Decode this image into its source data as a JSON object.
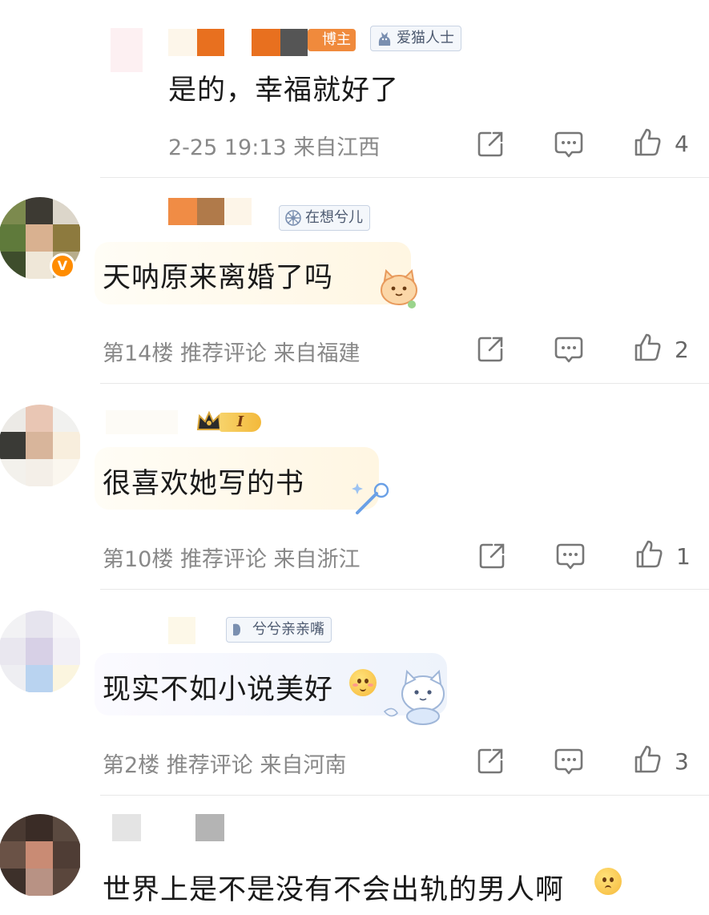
{
  "comments": [
    {
      "badge": "博主",
      "medal": "爱猫人士",
      "text": "是的，幸福就好了",
      "meta": "2-25 19:13  来自江西",
      "likes": "4"
    },
    {
      "medal": "在想兮儿",
      "text": "天呐原来离婚了吗",
      "meta": "第14楼  推荐评论  来自福建",
      "likes": "2",
      "verified": "V"
    },
    {
      "level": "I",
      "text": "很喜欢她写的书",
      "meta": "第10楼  推荐评论  来自浙江",
      "likes": "1"
    },
    {
      "medal": "兮兮亲亲嘴",
      "text": "现实不如小说美好",
      "meta": "第2楼  推荐评论  来自河南",
      "likes": "3"
    },
    {
      "text": "世界上是不是没有不会出轨的男人啊"
    }
  ],
  "icons": {
    "share": "share-icon",
    "comment": "comment-icon",
    "like": "thumbs-up-icon"
  },
  "colors": {
    "text": "#1a1a1a",
    "meta": "#888888",
    "verified": "#ff8c00",
    "medal_text": "#4d5a70"
  }
}
